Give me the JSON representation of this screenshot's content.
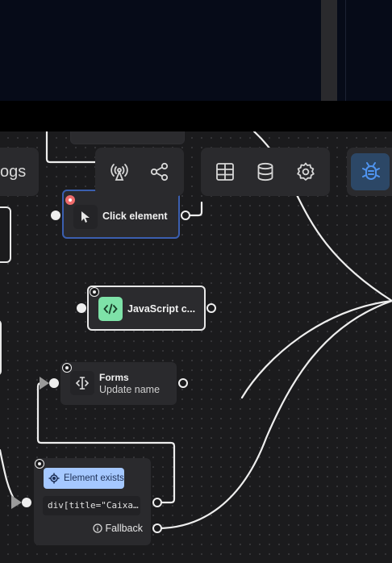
{
  "toolbar": {
    "logs_label": "ogs",
    "group1": [
      {
        "icon": "broadcast-icon"
      },
      {
        "icon": "share-icon"
      }
    ],
    "group2": [
      {
        "icon": "table-icon"
      },
      {
        "icon": "database-icon"
      },
      {
        "icon": "settings-icon"
      }
    ],
    "debug": {
      "icon": "bug-icon"
    }
  },
  "nodes": {
    "click": {
      "title": "Click element",
      "status_color": "#ef6b6b",
      "icon": "cursor-icon"
    },
    "javascript": {
      "title": "JavaScript c...",
      "icon": "code-icon",
      "accent": "#7ee2a8"
    },
    "forms": {
      "title": "Forms",
      "subtitle": "Update name",
      "icon": "text-cursor-icon"
    },
    "condition": {
      "chip_label": "Element exists",
      "chip_icon": "target-icon",
      "selector": "div[title=\"Caixa…",
      "fallback_label": "Fallback",
      "fallback_icon": "info-icon",
      "accent": "#a5c8ff"
    }
  },
  "colors": {
    "canvas": "#1b1b1d",
    "selection": "#3b5fb0",
    "debug_active": "#2c4766",
    "debug_icon": "#4f94f0"
  }
}
